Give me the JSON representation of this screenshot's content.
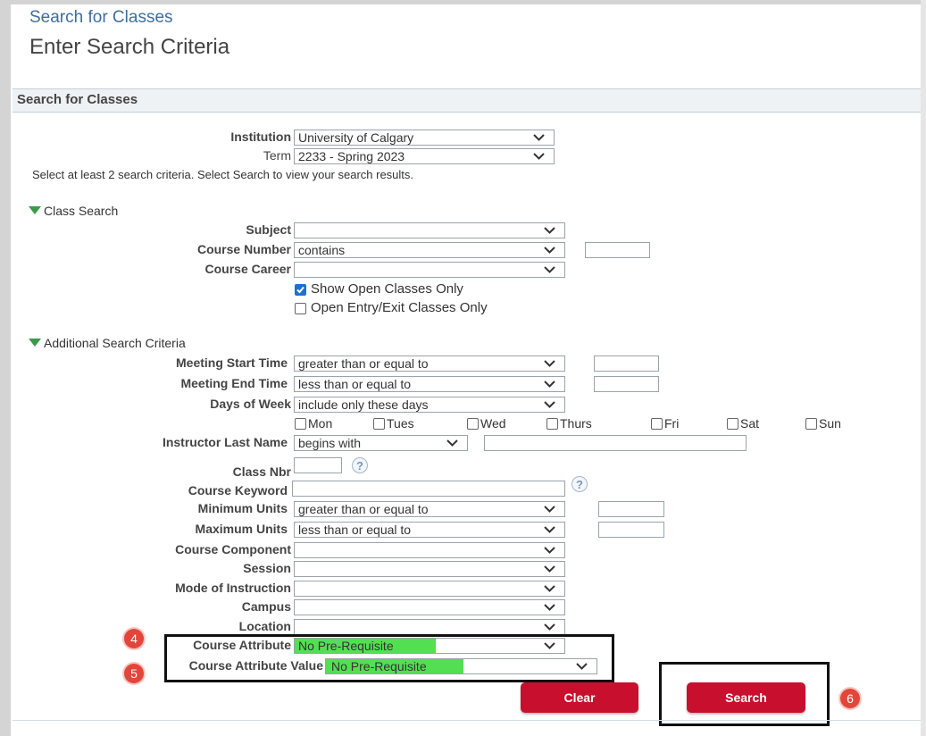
{
  "breadcrumb": "Search for Classes",
  "page_title": "Enter Search Criteria",
  "section_title": "Search for Classes",
  "institution": {
    "label": "Institution",
    "value": "University of Calgary"
  },
  "term": {
    "label": "Term",
    "value": "2233 - Spring 2023"
  },
  "instruction": "Select at least 2 search criteria. Select Search to view your search results.",
  "class_search": {
    "heading": "Class Search",
    "subject_label": "Subject",
    "subject_value": "",
    "course_number_label": "Course Number",
    "course_number_op": "contains",
    "course_career_label": "Course Career",
    "course_career_value": "",
    "show_open_label": "Show Open Classes Only",
    "show_open_checked": true,
    "open_entry_label": "Open Entry/Exit Classes Only",
    "open_entry_checked": false
  },
  "additional": {
    "heading": "Additional Search Criteria",
    "meeting_start_label": "Meeting Start Time",
    "meeting_start_op": "greater than or equal to",
    "meeting_end_label": "Meeting End Time",
    "meeting_end_op": "less than or equal to",
    "days_label": "Days of Week",
    "days_op": "include only these days",
    "days": [
      "Mon",
      "Tues",
      "Wed",
      "Thurs",
      "Fri",
      "Sat",
      "Sun"
    ],
    "instructor_label": "Instructor Last Name",
    "instructor_op": "begins with",
    "class_nbr_label": "Class Nbr",
    "course_keyword_label": "Course Keyword",
    "min_units_label": "Minimum Units",
    "min_units_op": "greater than or equal to",
    "max_units_label": "Maximum Units",
    "max_units_op": "less than or equal to",
    "course_component_label": "Course Component",
    "session_label": "Session",
    "mode_label": "Mode of Instruction",
    "campus_label": "Campus",
    "location_label": "Location",
    "course_attribute_label": "Course Attribute",
    "course_attribute_value": "No Pre-Requisite",
    "course_attribute_value_label": "Course Attribute Value",
    "course_attribute_value_value": "No Pre-Requisite"
  },
  "help_glyph": "?",
  "buttons": {
    "clear": "Clear",
    "search": "Search"
  },
  "badges": {
    "four": "4",
    "five": "5",
    "six": "6"
  },
  "colors": {
    "button_red": "#c8102e",
    "highlight_green": "#52e052",
    "badge_red": "#e2463a",
    "link_blue": "#3c6e9f"
  }
}
